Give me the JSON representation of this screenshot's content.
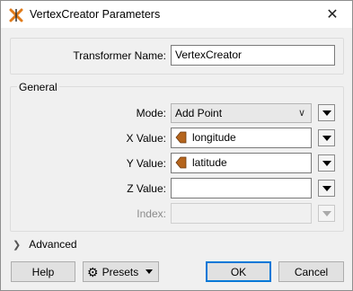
{
  "window": {
    "title": "VertexCreator Parameters",
    "icon": "transformer-icon",
    "close_label": "✕"
  },
  "transformer": {
    "label": "Transformer Name:",
    "value": "VertexCreator"
  },
  "general": {
    "section_label": "General",
    "mode": {
      "label": "Mode:",
      "value": "Add Point"
    },
    "x": {
      "label": "X Value:",
      "value": "longitude",
      "icon": "attribute-icon"
    },
    "y": {
      "label": "Y Value:",
      "value": "latitude",
      "icon": "attribute-icon"
    },
    "z": {
      "label": "Z Value:",
      "value": ""
    },
    "index": {
      "label": "Index:",
      "value": ""
    }
  },
  "advanced": {
    "label": "Advanced"
  },
  "buttons": {
    "help": "Help",
    "presets": "Presets",
    "ok": "OK",
    "cancel": "Cancel"
  },
  "colors": {
    "attribute_icon": "#b5651d",
    "primary_border": "#0078d7"
  }
}
